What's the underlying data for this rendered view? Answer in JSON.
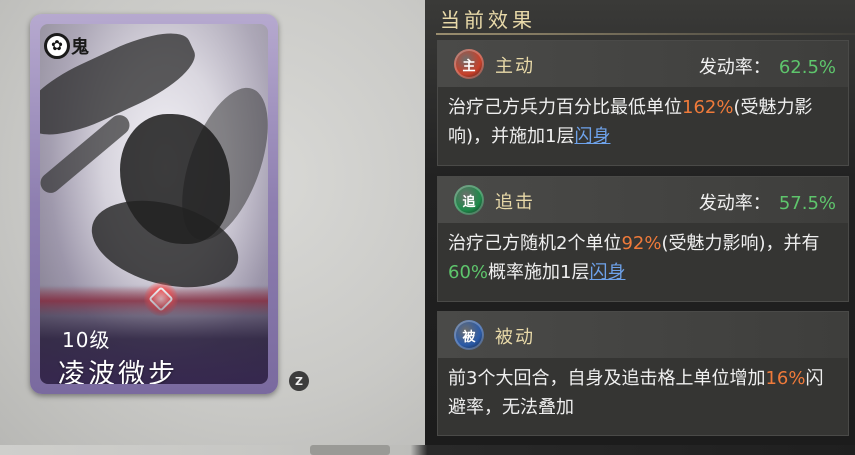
{
  "card": {
    "badge": "鬼",
    "level": "10级",
    "name": "凌波微步",
    "hotkey": "Z"
  },
  "panel": {
    "title": "当前效果",
    "rate_label": "发动率：",
    "effects": [
      {
        "type": "主动",
        "icon_char": "主",
        "icon_color": "#c8402a",
        "rate": "62.5%",
        "desc_parts": [
          {
            "text": "治疗己方兵力百分比最低单位",
            "style": "plain"
          },
          {
            "text": "162%",
            "style": "orange"
          },
          {
            "text": "(受魅力影响)，并施加1层",
            "style": "plain"
          },
          {
            "text": "闪身",
            "style": "link"
          }
        ]
      },
      {
        "type": "追击",
        "icon_char": "追",
        "icon_color": "#1e8a4a",
        "rate": "57.5%",
        "desc_parts": [
          {
            "text": "治疗己方随机2个单位",
            "style": "plain"
          },
          {
            "text": "92%",
            "style": "orange"
          },
          {
            "text": "(受魅力影响)，并有",
            "style": "plain"
          },
          {
            "text": "60%",
            "style": "green"
          },
          {
            "text": "概率施加1层",
            "style": "plain"
          },
          {
            "text": "闪身",
            "style": "link"
          }
        ]
      },
      {
        "type": "被动",
        "icon_char": "被",
        "icon_color": "#2a5aa8",
        "rate": "",
        "desc_parts": [
          {
            "text": "前3个大回合，自身及追击格上单位增加",
            "style": "plain"
          },
          {
            "text": "16%",
            "style": "orange"
          },
          {
            "text": "闪避率，无法叠加",
            "style": "plain"
          }
        ]
      }
    ]
  },
  "colors": {
    "title_gold": "#e8d9a8",
    "rate_green": "#5ec56c",
    "value_orange": "#ef7a3a",
    "link_blue": "#6ea2ea"
  }
}
